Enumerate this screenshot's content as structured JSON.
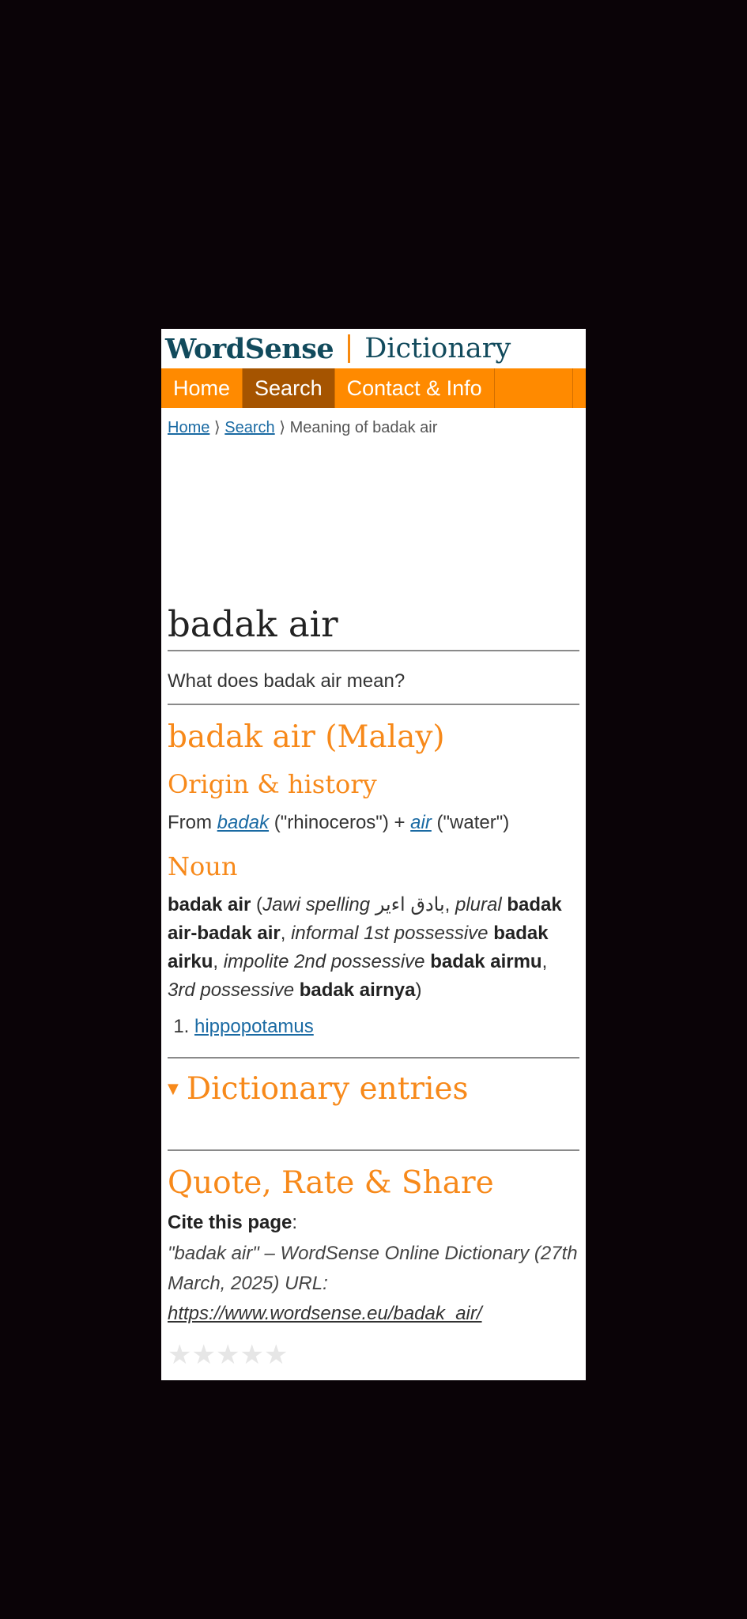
{
  "logo": {
    "brand": "WordSense",
    "product": "Dictionary"
  },
  "nav": {
    "items": [
      {
        "label": "Home"
      },
      {
        "label": "Search"
      },
      {
        "label": "Contact & Info"
      }
    ]
  },
  "breadcrumb": {
    "home": "Home",
    "search": "Search",
    "current": "Meaning of badak air",
    "sep": "⟩"
  },
  "headword": "badak air",
  "question": "What does badak air mean?",
  "language_heading": "badak air (Malay)",
  "etymology": {
    "heading": "Origin & history",
    "from": "From",
    "link1": "badak",
    "gloss1": "(\"rhinoceros\") +",
    "link2": "air",
    "gloss2": "(\"water\")"
  },
  "noun": {
    "heading": "Noun",
    "form": "badak air",
    "jawi_label": "Jawi spelling",
    "jawi": "بادق اءير",
    "plural_label": "plural",
    "plural": "badak air-badak air",
    "p1_label": "informal 1st possessive",
    "p1": "badak airku",
    "p2_label": "impolite 2nd possessive",
    "p2": "badak airmu",
    "p3_label": "3rd possessive",
    "p3": "badak airnya",
    "definitions": [
      "hippopotamus"
    ]
  },
  "dictionary_entries": "Dictionary entries",
  "share": {
    "heading": "Quote, Rate & Share",
    "cite_label": "Cite this page",
    "cite_text": "\"badak air\" – WordSense Online Dictionary (27th March, 2025) URL:",
    "cite_url": "https://www.wordsense.eu/badak_air/"
  },
  "rating": {
    "stars": 5,
    "value": 0
  },
  "colors": {
    "accent": "#ff8a00",
    "nav_active": "#a55400",
    "heading": "#f7891a",
    "link": "#1a6aa3"
  }
}
